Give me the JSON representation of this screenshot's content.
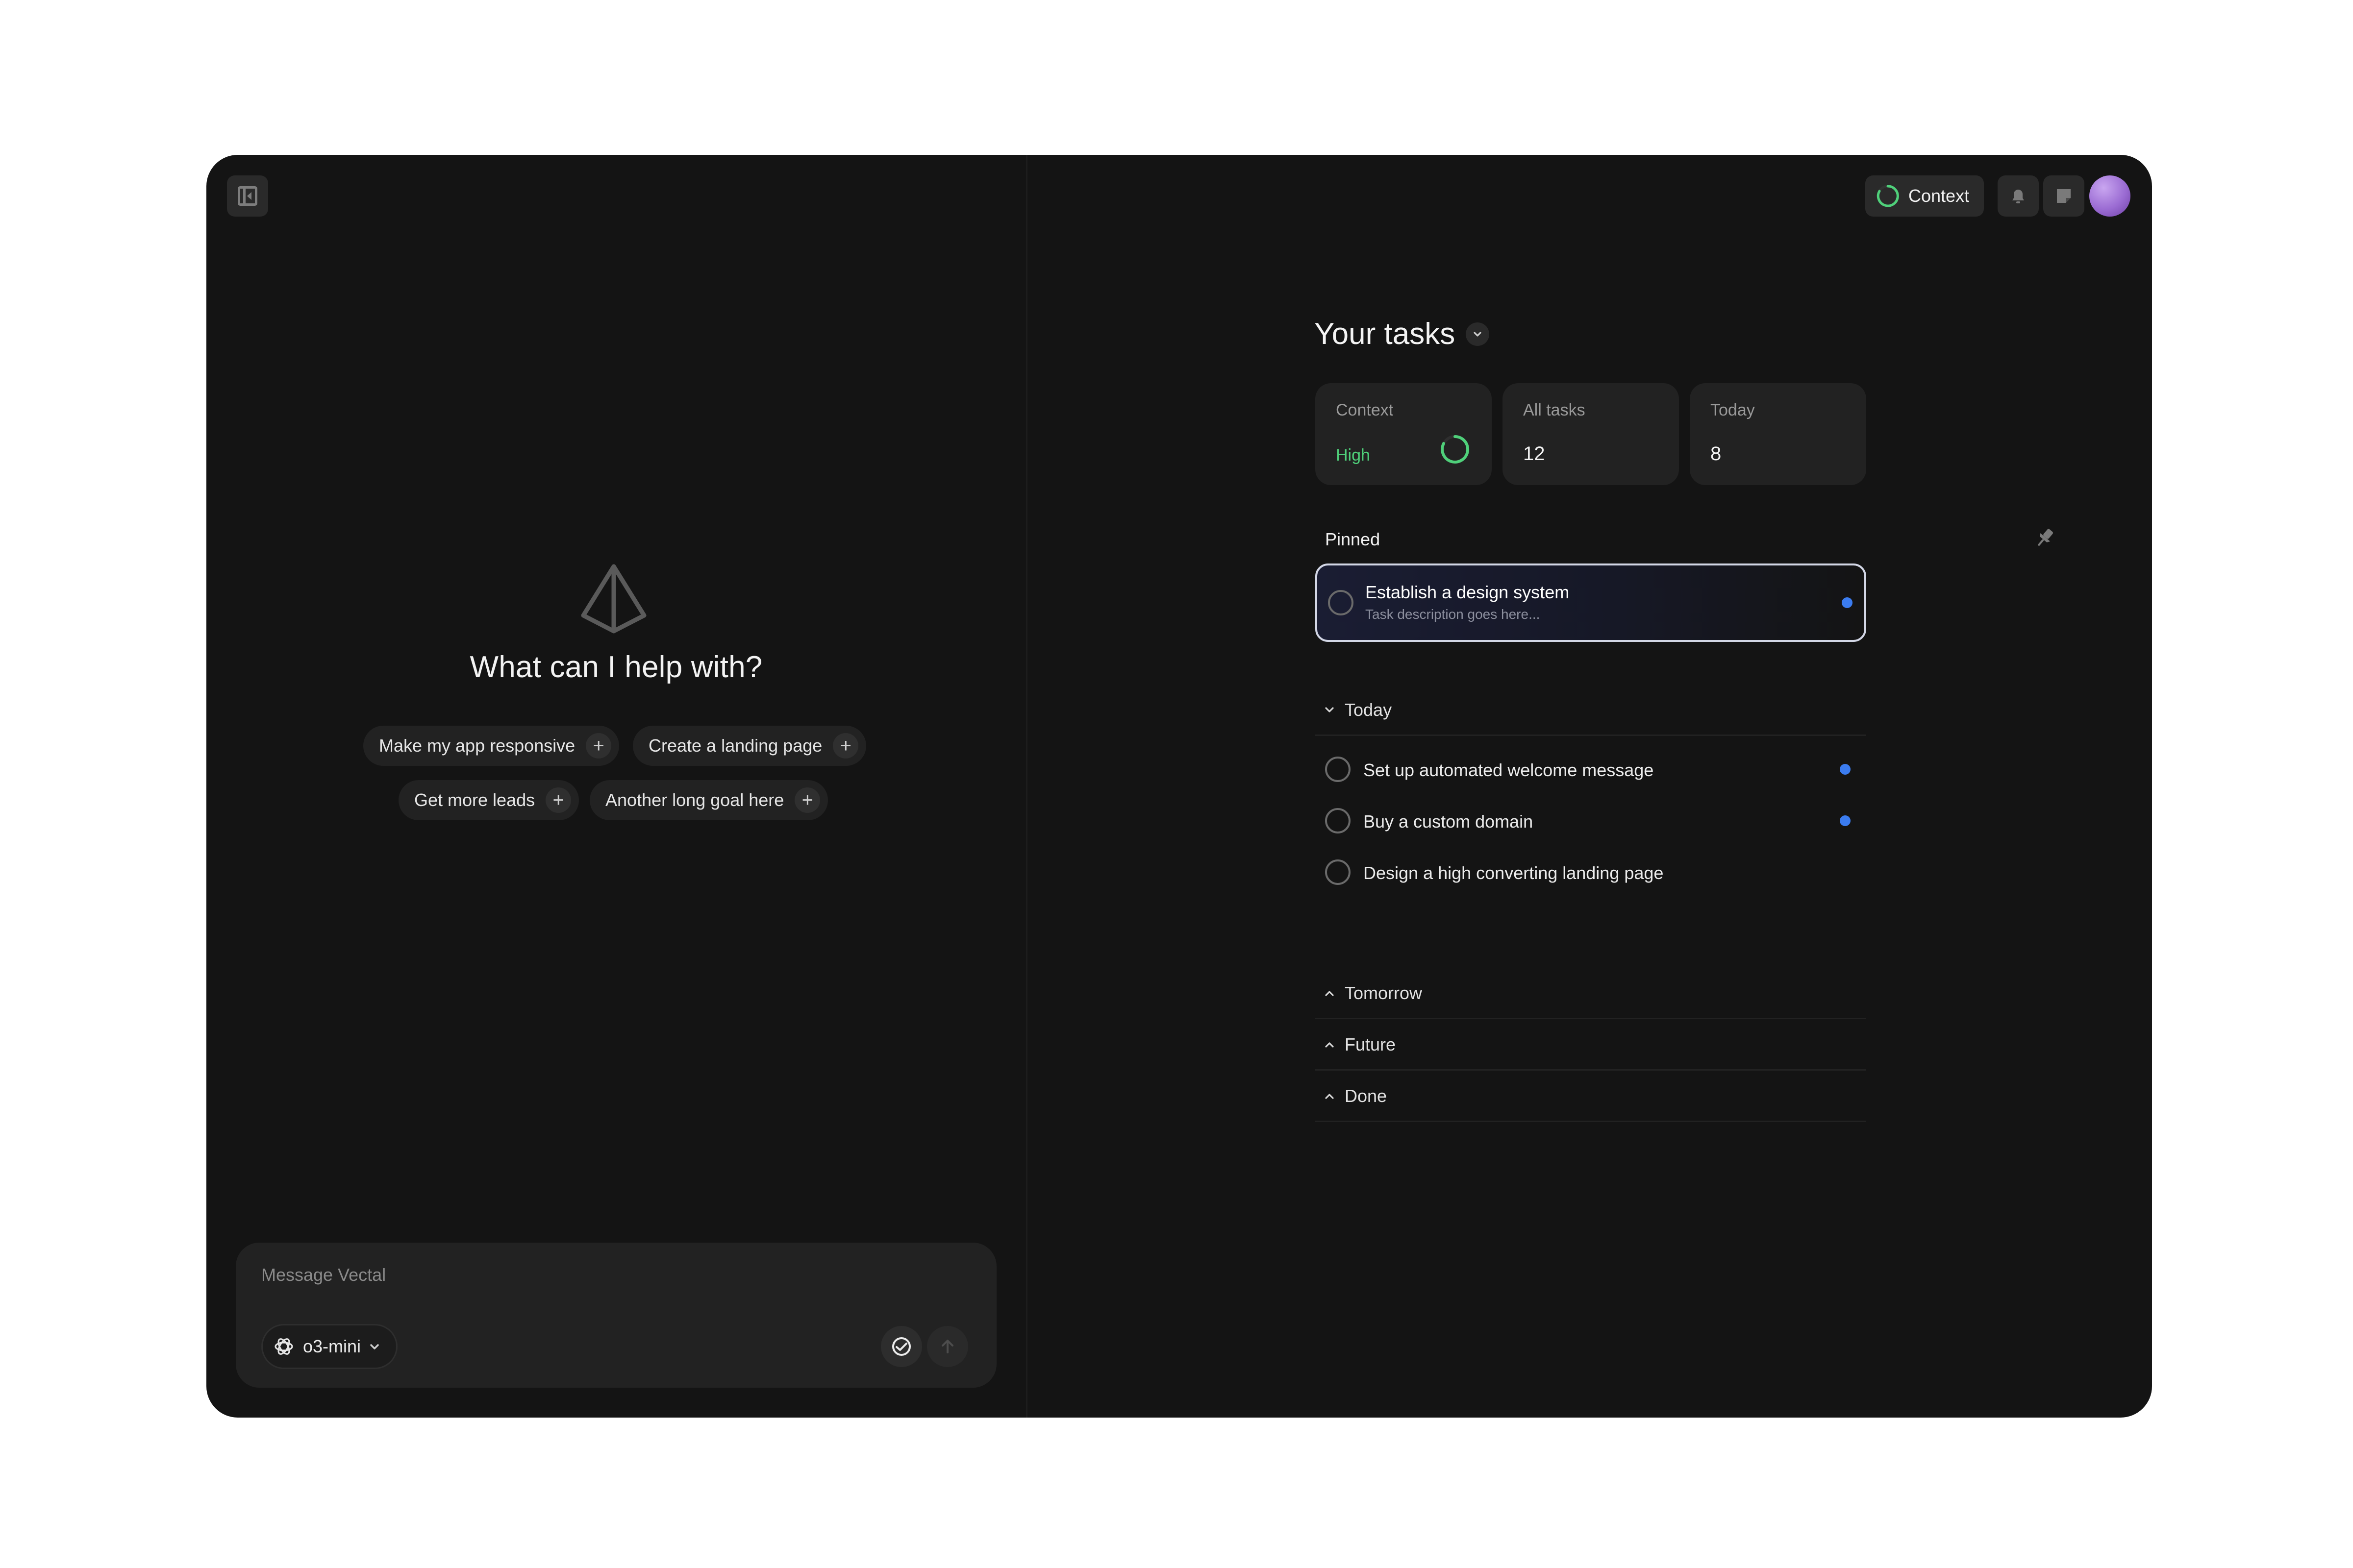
{
  "headline": "What can I help with?",
  "suggestions": [
    {
      "label": "Make my app responsive"
    },
    {
      "label": "Create a landing page"
    },
    {
      "label": "Get more leads"
    },
    {
      "label": "Another long goal here"
    }
  ],
  "composer": {
    "placeholder": "Message Vectal",
    "model": "o3-mini"
  },
  "topbar": {
    "context_label": "Context"
  },
  "tasks": {
    "title": "Your tasks",
    "stats": [
      {
        "label": "Context",
        "value": "High"
      },
      {
        "label": "All tasks",
        "value": "12"
      },
      {
        "label": "Today",
        "value": "8"
      }
    ],
    "pinned_label": "Pinned",
    "pinned": {
      "title": "Establish a design system",
      "description": "Task description goes here..."
    },
    "sections": {
      "today": "Today",
      "tomorrow": "Tomorrow",
      "future": "Future",
      "done": "Done"
    },
    "today_items": [
      {
        "title": "Set up automated welcome message",
        "flagged": true
      },
      {
        "title": "Buy a custom domain",
        "flagged": true
      },
      {
        "title": "Design a high converting landing page",
        "flagged": false
      }
    ]
  },
  "colors": {
    "background": "#141414",
    "surface": "#222222",
    "accent_green": "#4fd07a",
    "accent_blue": "#3b7cf0"
  }
}
